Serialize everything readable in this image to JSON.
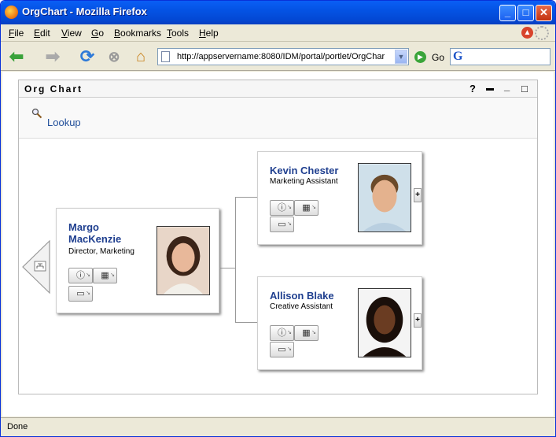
{
  "window": {
    "title": "OrgChart - Mozilla Firefox"
  },
  "menu": [
    "File",
    "Edit",
    "View",
    "Go",
    "Bookmarks",
    "Tools",
    "Help"
  ],
  "nav": {
    "url": "http://appservername:8080/IDM/portal/portlet/OrgChar",
    "go_label": "Go",
    "search_value": ""
  },
  "portlet": {
    "title": "Org Chart",
    "controls": {
      "help": "?",
      "print": "▬",
      "minimize": "_",
      "maximize": "□"
    },
    "lookup_label": "Lookup"
  },
  "chart": {
    "manager": {
      "name_line1": "Margo",
      "name_line2": "MacKenzie",
      "title": "Director, Marketing"
    },
    "reports": [
      {
        "name": "Kevin Chester",
        "title": "Marketing Assistant"
      },
      {
        "name": "Allison Blake",
        "title": "Creative Assistant"
      }
    ],
    "expand_label": "+"
  },
  "status": {
    "text": "Done"
  }
}
